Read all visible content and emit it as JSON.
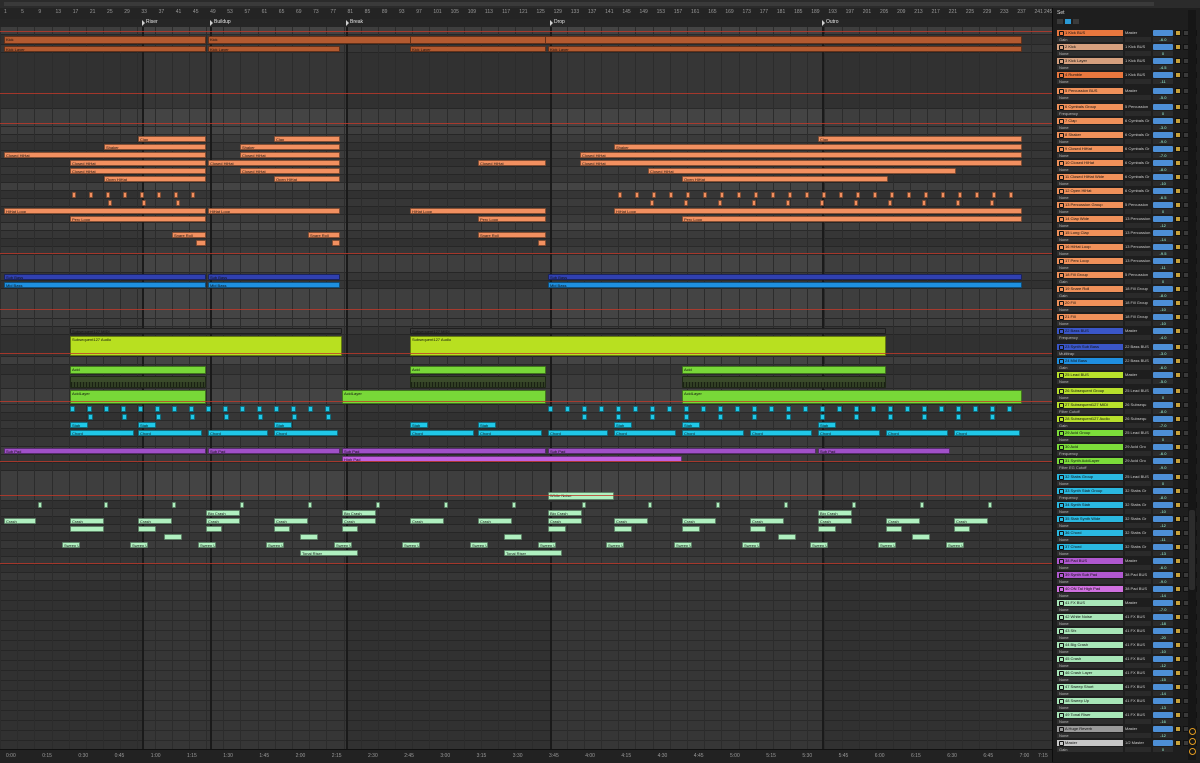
{
  "sections": [
    "Riser",
    "Buildup",
    "Break",
    "Drop",
    "Outro"
  ],
  "bar_numbers": [
    "1",
    "5",
    "9",
    "13",
    "17",
    "21",
    "25",
    "29",
    "33",
    "37",
    "41",
    "45",
    "49",
    "53",
    "57",
    "61",
    "65",
    "69",
    "73",
    "77",
    "81",
    "85",
    "89",
    "93",
    "97",
    "101",
    "105",
    "109",
    "113",
    "117",
    "121",
    "125",
    "129",
    "133",
    "137",
    "141",
    "145",
    "149",
    "153",
    "157",
    "161",
    "165",
    "169",
    "173",
    "177",
    "181",
    "185",
    "189",
    "193",
    "197",
    "201",
    "205",
    "209",
    "213",
    "217",
    "221",
    "225",
    "229",
    "233",
    "237",
    "241",
    "245"
  ],
  "time_labels": [
    "0:00",
    "0:15",
    "0:30",
    "0:45",
    "1:00",
    "1:15",
    "1:30",
    "1:45",
    "2:00",
    "2:15",
    "2:30",
    "2:45",
    "3:00",
    "3:15",
    "3:30",
    "3:45",
    "4:00",
    "4:15",
    "4:30",
    "4:45",
    "5:00",
    "5:15",
    "5:30",
    "5:45",
    "6:00",
    "6:15",
    "6:30",
    "6:45",
    "7:00",
    "7:15"
  ],
  "panel_title": "Set",
  "clip_names": {
    "kick": "Kick",
    "kick_layer": "Kick Layer",
    "clap": "Clap",
    "shaker": "Shaker",
    "closed_hihat": "Closed HiHat",
    "open_hihat": "Open HiHat",
    "hihat_loop": "HiHat Loop",
    "perc_loop": "Perc Loop",
    "snare_roll": "Snare Roll",
    "sub_bass": "Sub Bass",
    "mid_bass": "Mid Bass",
    "seq_midi": "Subsequent127 MIDI",
    "seq_audio": "Subsequent127 Audio",
    "clip_env": "Clip Env Enabled",
    "acid": "Acid",
    "acid_layer": "AcidLayer",
    "stab": "Stab",
    "chord": "Chord",
    "sub_pad": "Sub Pad",
    "high_pad": "High Pad",
    "white_noise": "White Noise",
    "big_crash": "Big Crash",
    "crash": "Crash",
    "sweep_up": "Sweep Up",
    "tonal_riser": "Tonal Riser"
  },
  "tracks": [
    {
      "name": "1 Kick BUS",
      "color": "#e8773e",
      "sub": "Gain",
      "route": "Master",
      "value": "-6.0"
    },
    {
      "name": "2 Kick",
      "color": "#d6a07e",
      "sub": "None",
      "route": "1 Kick BUS",
      "value": "0"
    },
    {
      "name": "3 Kick Layer",
      "color": "#d6a07e",
      "sub": "None",
      "route": "1 Kick BUS",
      "value": "-4.5"
    },
    {
      "name": "4 Rumble",
      "color": "#e8773e",
      "sub": "None",
      "route": "1 Kick BUS",
      "value": "-11"
    },
    {
      "name": "5 Percussion BUS",
      "color": "#f0915a",
      "sub": "None",
      "route": "Master",
      "value": "-5.0"
    },
    {
      "name": "6 Cymbals Group",
      "color": "#f0915a",
      "sub": "Frequency",
      "route": "5 Percussion",
      "value": "0"
    },
    {
      "name": "7 Clap",
      "color": "#f0915a",
      "sub": "None",
      "route": "6 Cymbals Gr",
      "value": "-3.0"
    },
    {
      "name": "8 Shaker",
      "color": "#f0915a",
      "sub": "None",
      "route": "6 Cymbals Gr",
      "value": "-9.0"
    },
    {
      "name": "9 Closed HiHat",
      "color": "#f0915a",
      "sub": "None",
      "route": "6 Cymbals Gr",
      "value": "-7.0"
    },
    {
      "name": "10 Closed HiHat",
      "color": "#f0915a",
      "sub": "None",
      "route": "6 Cymbals Gr",
      "value": "-8.0"
    },
    {
      "name": "11 Closed HiHat Wide",
      "color": "#f0915a",
      "sub": "None",
      "route": "6 Cymbals Gr",
      "value": "-10"
    },
    {
      "name": "12 Open HiHat",
      "color": "#f0915a",
      "sub": "None",
      "route": "6 Cymbals Gr",
      "value": "-6.5"
    },
    {
      "name": "13 Percussion Group",
      "color": "#f0915a",
      "sub": "None",
      "route": "5 Percussion",
      "value": "0"
    },
    {
      "name": "14 Clap Wide",
      "color": "#f0915a",
      "sub": "None",
      "route": "13 Percussion",
      "value": "-12"
    },
    {
      "name": "15 Long Clap",
      "color": "#f0915a",
      "sub": "None",
      "route": "13 Percussion",
      "value": "-14"
    },
    {
      "name": "16 HiHat Loop",
      "color": "#f0915a",
      "sub": "None",
      "route": "13 Percussion",
      "value": "-9.5"
    },
    {
      "name": "17 Perc Loop",
      "color": "#f0915a",
      "sub": "None",
      "route": "13 Percussion",
      "value": "-11"
    },
    {
      "name": "18 Fill Group",
      "color": "#f0915a",
      "sub": "Gain",
      "route": "5 Percussion",
      "value": "0"
    },
    {
      "name": "19 Snare Roll",
      "color": "#f0915a",
      "sub": "Gain",
      "route": "18 Fill Group",
      "value": "-8.0"
    },
    {
      "name": "20 Fill",
      "color": "#f0915a",
      "sub": "None",
      "route": "18 Fill Group",
      "value": "-10"
    },
    {
      "name": "21 Fill",
      "color": "#f0915a",
      "sub": "None",
      "route": "18 Fill Group",
      "value": "-10"
    },
    {
      "name": "22 Bass BUS",
      "color": "#3a56c8",
      "sub": "Frequency",
      "route": "Master",
      "value": "-4.0"
    },
    {
      "name": "23 Synth Sub Bass",
      "color": "#3a56c8",
      "sub": "Multitrap",
      "route": "22 Bass BUS",
      "value": "-3.0"
    },
    {
      "name": "24 Mid Bass",
      "color": "#1f8fe0",
      "sub": "Gain",
      "route": "22 Bass BUS",
      "value": "-6.0"
    },
    {
      "name": "25 Lead BUS",
      "color": "#b8e02c",
      "sub": "None",
      "route": "Master",
      "value": "-5.0"
    },
    {
      "name": "26 Subsequent Group",
      "color": "#b8e02c",
      "sub": "None",
      "route": "25 Lead BUS",
      "value": "0"
    },
    {
      "name": "27 Subsequent127 MIDI",
      "color": "#b8e02c",
      "sub": "Filter Cutoff",
      "route": "26 Subsequ",
      "value": "-8.0"
    },
    {
      "name": "28 Subsequent127 Audio",
      "color": "#b8e02c",
      "sub": "Gain",
      "route": "26 Subsequ",
      "value": "-7.0"
    },
    {
      "name": "29 Acid Group",
      "color": "#7cdc3a",
      "sub": "None",
      "route": "25 Lead BUS",
      "value": "0"
    },
    {
      "name": "30 Acid",
      "color": "#7cdc3a",
      "sub": "Frequency",
      "route": "29 Acid Gro",
      "value": "-6.0"
    },
    {
      "name": "31 Synth AcidLayer",
      "color": "#7cdc3a",
      "sub": "Filter EG Cutoff",
      "route": "29 Acid Gro",
      "value": "-9.0"
    },
    {
      "name": "32 Stabs Group",
      "color": "#2ab8e0",
      "sub": "None",
      "route": "25 Lead BUS",
      "value": "0"
    },
    {
      "name": "33 Synth Stab Group",
      "color": "#2ab8e0",
      "sub": "Frequency",
      "route": "32 Stabs Gr",
      "value": "-8.0"
    },
    {
      "name": "34 Synth Stab",
      "color": "#2ab8e0",
      "sub": "None",
      "route": "32 Stabs Gr",
      "value": "-10"
    },
    {
      "name": "35 Stab Synth Wide",
      "color": "#2ab8e0",
      "sub": "None",
      "route": "32 Stabs Gr",
      "value": "-12"
    },
    {
      "name": "36 Chord",
      "color": "#2ab8e0",
      "sub": "None",
      "route": "32 Stabs Gr",
      "value": "-11"
    },
    {
      "name": "37 Chord",
      "color": "#2ab8e0",
      "sub": "None",
      "route": "32 Stabs Gr",
      "value": "-13"
    },
    {
      "name": "38 Pad BUS",
      "color": "#b058d0",
      "sub": "None",
      "route": "Master",
      "value": "-6.0"
    },
    {
      "name": "39 Synth Sub Pad",
      "color": "#b058d0",
      "sub": "None",
      "route": "38 Pad BUS",
      "value": "-9.0"
    },
    {
      "name": "40 ON Tal High Pad",
      "color": "#d070e0",
      "sub": "None",
      "route": "38 Pad BUS",
      "value": "-14"
    },
    {
      "name": "41 FX BUS",
      "color": "#a8e6b8",
      "sub": "None",
      "route": "Master",
      "value": "-7.0"
    },
    {
      "name": "42 White Noise",
      "color": "#a8e6b8",
      "sub": "None",
      "route": "41 FX BUS",
      "value": "-18"
    },
    {
      "name": "43 Sfx",
      "color": "#a8e6b8",
      "sub": "None",
      "route": "41 FX BUS",
      "value": "-20"
    },
    {
      "name": "44 Big Crash",
      "color": "#a8e6b8",
      "sub": "None",
      "route": "41 FX BUS",
      "value": "-10"
    },
    {
      "name": "45 Crash",
      "color": "#a8e6b8",
      "sub": "None",
      "route": "41 FX BUS",
      "value": "-12"
    },
    {
      "name": "46 Crash Layer",
      "color": "#a8e6b8",
      "sub": "None",
      "route": "41 FX BUS",
      "value": "-15"
    },
    {
      "name": "47 Sweep Short",
      "color": "#a8e6b8",
      "sub": "None",
      "route": "41 FX BUS",
      "value": "-14"
    },
    {
      "name": "48 Sweep Up",
      "color": "#a8e6b8",
      "sub": "None",
      "route": "41 FX BUS",
      "value": "-13"
    },
    {
      "name": "49 Tonal Riser",
      "color": "#a8e6b8",
      "sub": "None",
      "route": "41 FX BUS",
      "value": "-16"
    },
    {
      "name": "A Huge Reverb",
      "color": "#9a9a9a",
      "sub": "None",
      "route": "Master",
      "value": "-12"
    },
    {
      "name": "Master",
      "color": "#c8c8c8",
      "sub": "Gain",
      "route": "1/2 Master",
      "value": "0"
    }
  ]
}
